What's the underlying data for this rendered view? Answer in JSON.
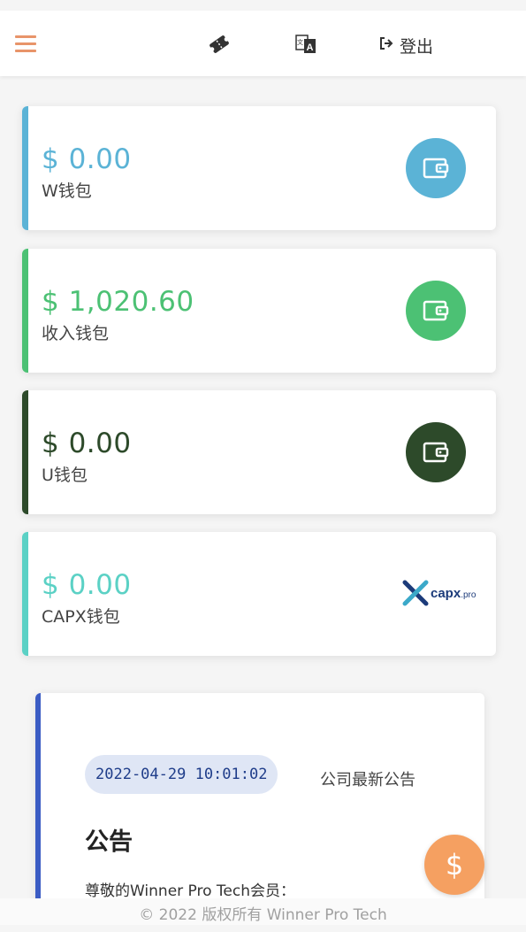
{
  "header": {
    "logout_label": "登出",
    "icons": [
      "menu-icon",
      "ticket-icon",
      "translate-icon",
      "logout-icon"
    ]
  },
  "wallets": [
    {
      "amount": "$ 0.00",
      "label": "W钱包",
      "color": "#5bb3d6",
      "icon": "wallet-icon"
    },
    {
      "amount": "$ 1,020.60",
      "label": "收入钱包",
      "color": "#4cc174",
      "icon": "wallet-icon"
    },
    {
      "amount": "$ 0.00",
      "label": "U钱包",
      "color": "#2d4a2a",
      "icon": "wallet-icon"
    },
    {
      "amount": "$ 0.00",
      "label": "CAPX钱包",
      "color": "#5bd1c5",
      "icon": "capx-logo",
      "logo_text": "capx",
      "logo_suffix": ".pro"
    }
  ],
  "notice": {
    "date": "2022-04-29 10:01:02",
    "tag": "公司最新公告",
    "title": "公告",
    "body": "尊敬的Winner Pro Tech会员："
  },
  "fab": {
    "symbol": "$"
  },
  "footer": {
    "text": "© 2022 版权所有 Winner Pro Tech"
  },
  "colors": {
    "accent": "#e8946a",
    "notice_bar": "#3b5cc4",
    "fab": "#f5a061"
  }
}
